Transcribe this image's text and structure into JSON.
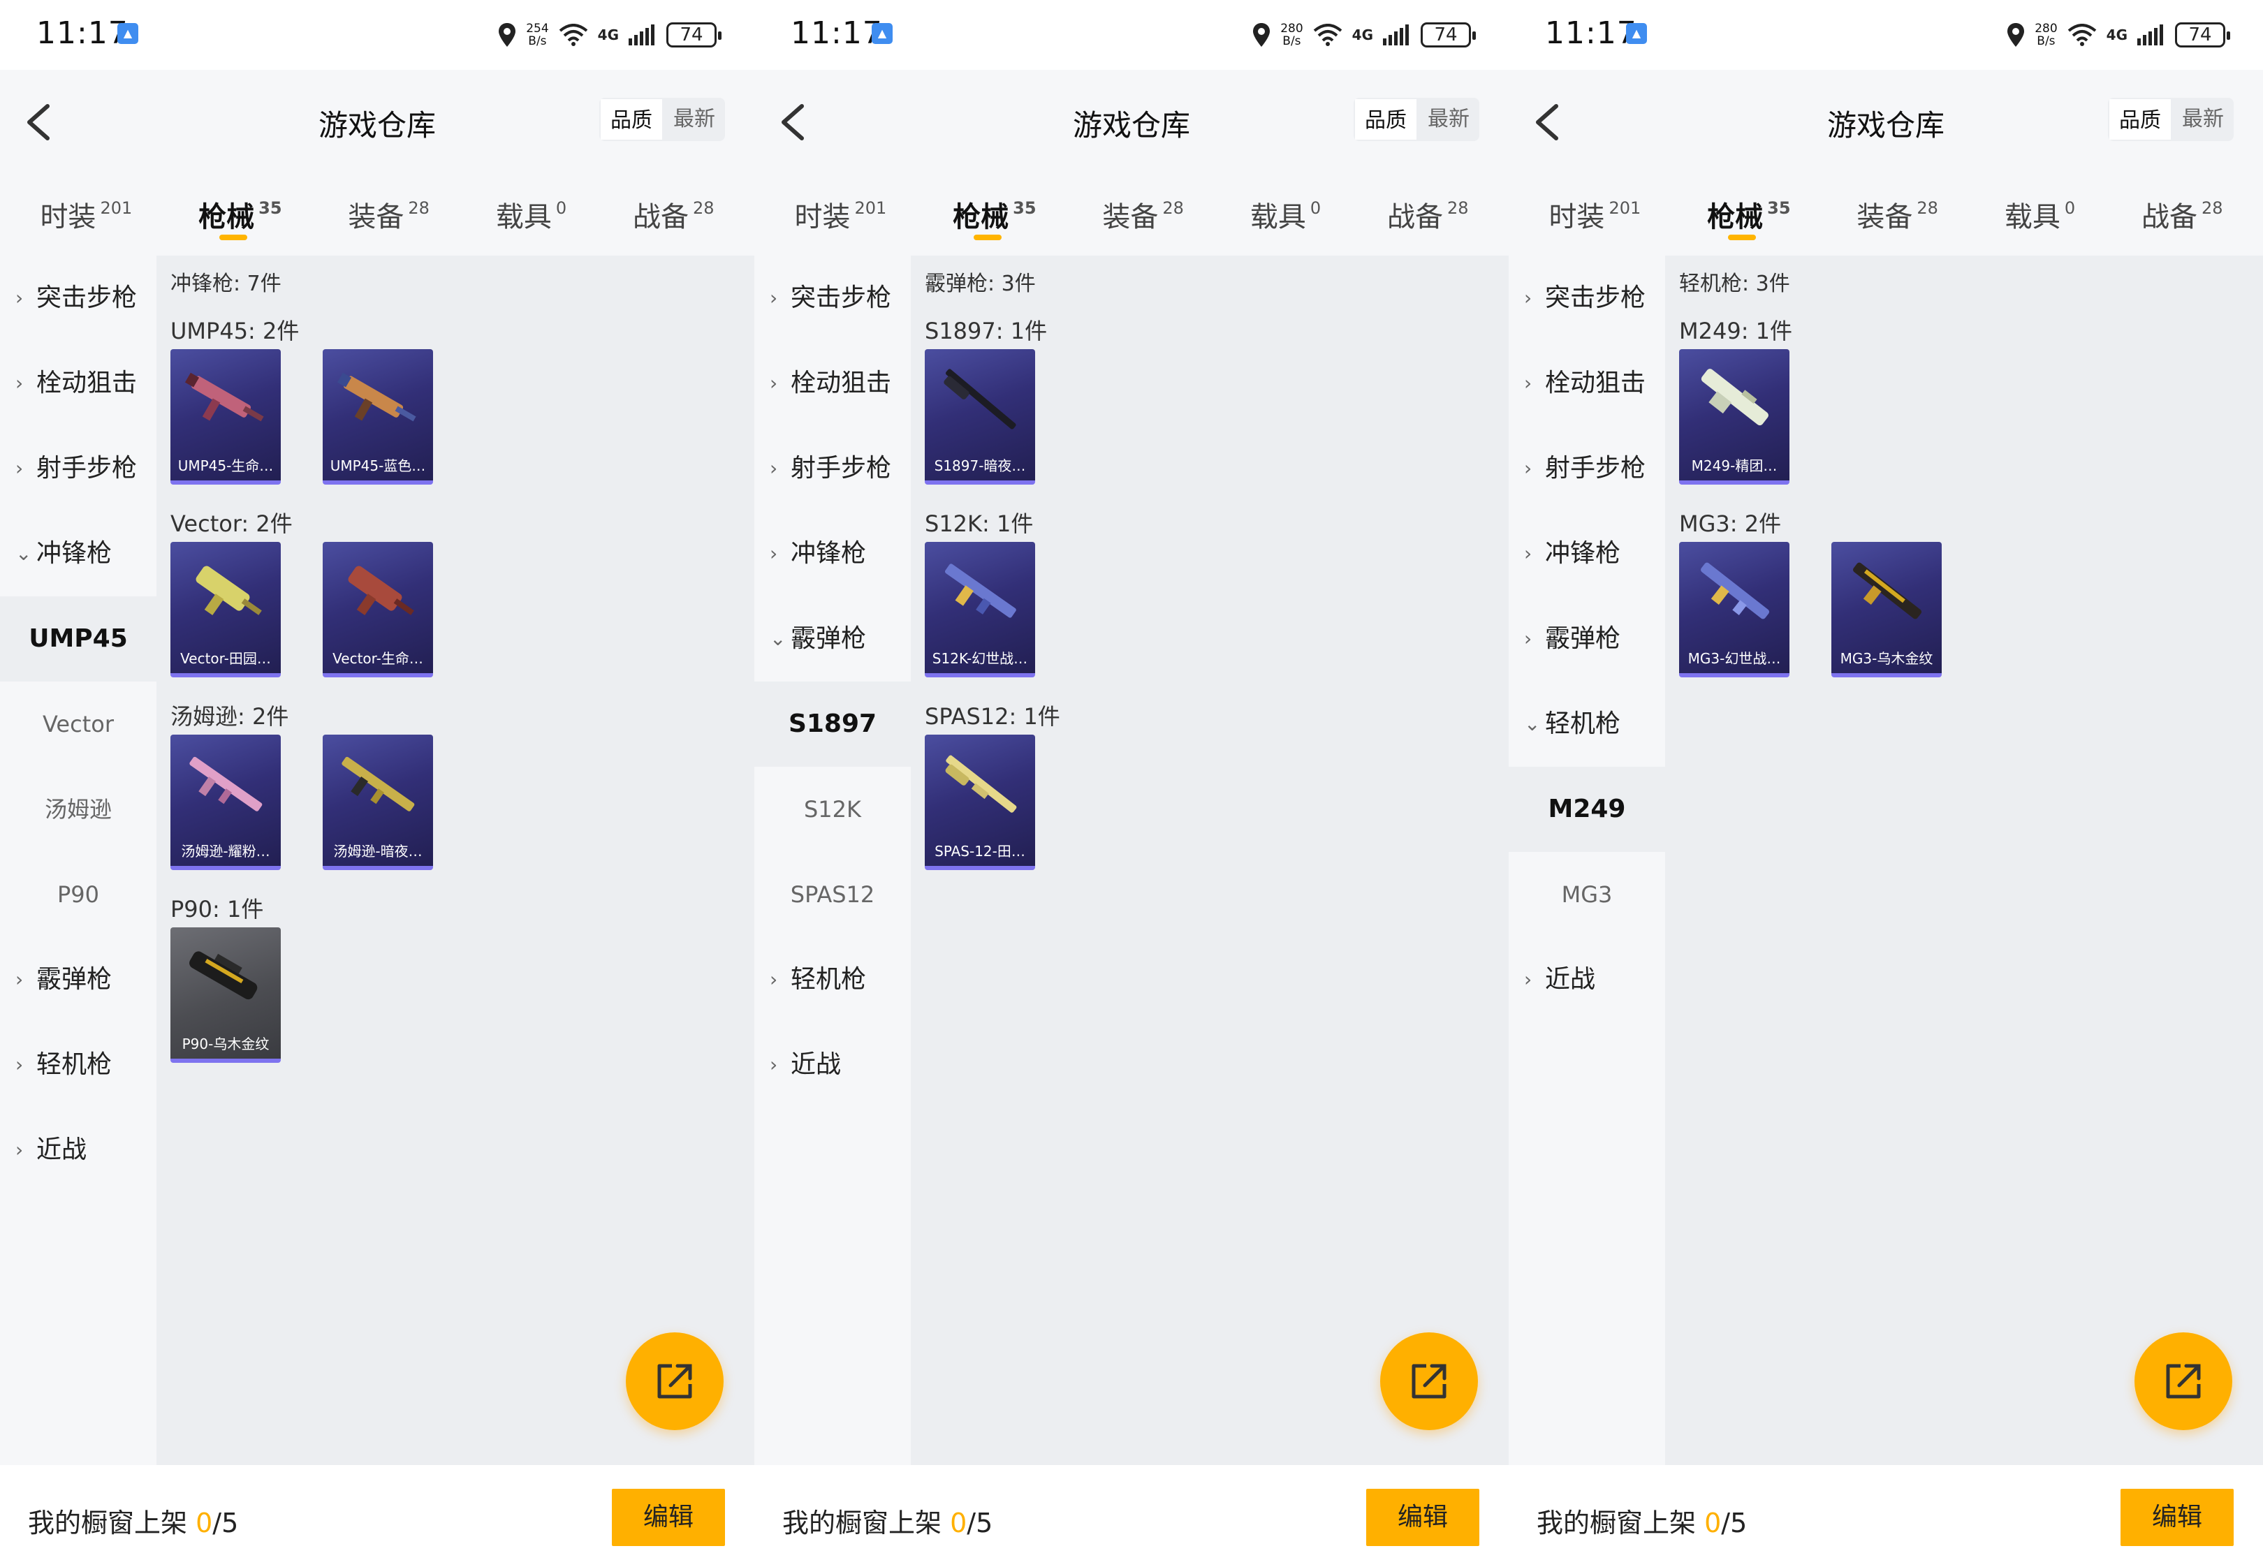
{
  "panels": [
    {
      "status": {
        "time": "11:17",
        "speed_top": "254",
        "speed_unit": "B/s",
        "network": "4G",
        "battery": "74"
      },
      "header": {
        "title": "游戏仓库",
        "sort_quality": "品质",
        "sort_newest": "最新"
      },
      "tabs": [
        {
          "label": "时装",
          "count": "201"
        },
        {
          "label": "枪械",
          "count": "35"
        },
        {
          "label": "装备",
          "count": "28"
        },
        {
          "label": "载具",
          "count": "0"
        },
        {
          "label": "战备",
          "count": "28"
        }
      ],
      "sidebar": [
        {
          "label": "突击步枪",
          "chevron": ">"
        },
        {
          "label": "栓动狙击",
          "chevron": ">"
        },
        {
          "label": "射手步枪",
          "chevron": ">"
        },
        {
          "label": "冲锋枪",
          "chevron": "v"
        },
        {
          "label": "UMP45"
        },
        {
          "label": "Vector"
        },
        {
          "label": "汤姆逊"
        },
        {
          "label": "P90"
        },
        {
          "label": "霰弹枪",
          "chevron": ">"
        },
        {
          "label": "轻机枪",
          "chevron": ">"
        },
        {
          "label": "近战",
          "chevron": ">"
        }
      ],
      "content": {
        "title": "冲锋枪: 7件",
        "groups": [
          {
            "title": "UMP45: 2件",
            "items": [
              {
                "caption": "UMP45-生命…"
              },
              {
                "caption": "UMP45-蓝色…"
              }
            ]
          },
          {
            "title": "Vector: 2件",
            "items": [
              {
                "caption": "Vector-田园…"
              },
              {
                "caption": "Vector-生命…"
              }
            ]
          },
          {
            "title": "汤姆逊: 2件",
            "items": [
              {
                "caption": "汤姆逊-耀粉…"
              },
              {
                "caption": "汤姆逊-暗夜…"
              }
            ]
          },
          {
            "title": "P90: 1件",
            "items": [
              {
                "caption": "P90-乌木金纹"
              }
            ]
          }
        ]
      },
      "bottom": {
        "label": "我的橱窗上架 ",
        "count": "0",
        "total": "/5",
        "edit": "编辑"
      }
    },
    {
      "status": {
        "time": "11:17",
        "speed_top": "280",
        "speed_unit": "B/s",
        "network": "4G",
        "battery": "74"
      },
      "header": {
        "title": "游戏仓库",
        "sort_quality": "品质",
        "sort_newest": "最新"
      },
      "tabs": [
        {
          "label": "时装",
          "count": "201"
        },
        {
          "label": "枪械",
          "count": "35"
        },
        {
          "label": "装备",
          "count": "28"
        },
        {
          "label": "载具",
          "count": "0"
        },
        {
          "label": "战备",
          "count": "28"
        }
      ],
      "sidebar": [
        {
          "label": "突击步枪",
          "chevron": ">"
        },
        {
          "label": "栓动狙击",
          "chevron": ">"
        },
        {
          "label": "射手步枪",
          "chevron": ">"
        },
        {
          "label": "冲锋枪",
          "chevron": ">"
        },
        {
          "label": "霰弹枪",
          "chevron": "v"
        },
        {
          "label": "S1897"
        },
        {
          "label": "S12K"
        },
        {
          "label": "SPAS12"
        },
        {
          "label": "轻机枪",
          "chevron": ">"
        },
        {
          "label": "近战",
          "chevron": ">"
        }
      ],
      "content": {
        "title": "霰弹枪: 3件",
        "groups": [
          {
            "title": "S1897: 1件",
            "items": [
              {
                "caption": "S1897-暗夜…"
              }
            ]
          },
          {
            "title": "S12K: 1件",
            "items": [
              {
                "caption": "S12K-幻世战…"
              }
            ]
          },
          {
            "title": "SPAS12: 1件",
            "items": [
              {
                "caption": "SPAS-12-田…"
              }
            ]
          }
        ]
      },
      "bottom": {
        "label": "我的橱窗上架 ",
        "count": "0",
        "total": "/5",
        "edit": "编辑"
      }
    },
    {
      "status": {
        "time": "11:17",
        "speed_top": "280",
        "speed_unit": "B/s",
        "network": "4G",
        "battery": "74"
      },
      "header": {
        "title": "游戏仓库",
        "sort_quality": "品质",
        "sort_newest": "最新"
      },
      "tabs": [
        {
          "label": "时装",
          "count": "201"
        },
        {
          "label": "枪械",
          "count": "35"
        },
        {
          "label": "装备",
          "count": "28"
        },
        {
          "label": "载具",
          "count": "0"
        },
        {
          "label": "战备",
          "count": "28"
        }
      ],
      "sidebar": [
        {
          "label": "突击步枪",
          "chevron": ">"
        },
        {
          "label": "栓动狙击",
          "chevron": ">"
        },
        {
          "label": "射手步枪",
          "chevron": ">"
        },
        {
          "label": "冲锋枪",
          "chevron": ">"
        },
        {
          "label": "霰弹枪",
          "chevron": ">"
        },
        {
          "label": "轻机枪",
          "chevron": "v"
        },
        {
          "label": "M249"
        },
        {
          "label": "MG3"
        },
        {
          "label": "近战",
          "chevron": ">"
        }
      ],
      "content": {
        "title": "轻机枪: 3件",
        "groups": [
          {
            "title": "M249: 1件",
            "items": [
              {
                "caption": "M249-精团…"
              }
            ]
          },
          {
            "title": "MG3: 2件",
            "items": [
              {
                "caption": "MG3-幻世战…"
              },
              {
                "caption": "MG3-乌木金纹"
              }
            ]
          }
        ]
      },
      "bottom": {
        "label": "我的橱窗上架 ",
        "count": "0",
        "total": "/5",
        "edit": "编辑"
      }
    }
  ],
  "colors": {
    "accent": "#ffb000",
    "card_bg": "#322f77",
    "card_underline": "#7e73ef",
    "sidebar_bg": "#f6f7f9",
    "content_bg": "#eceef1"
  }
}
